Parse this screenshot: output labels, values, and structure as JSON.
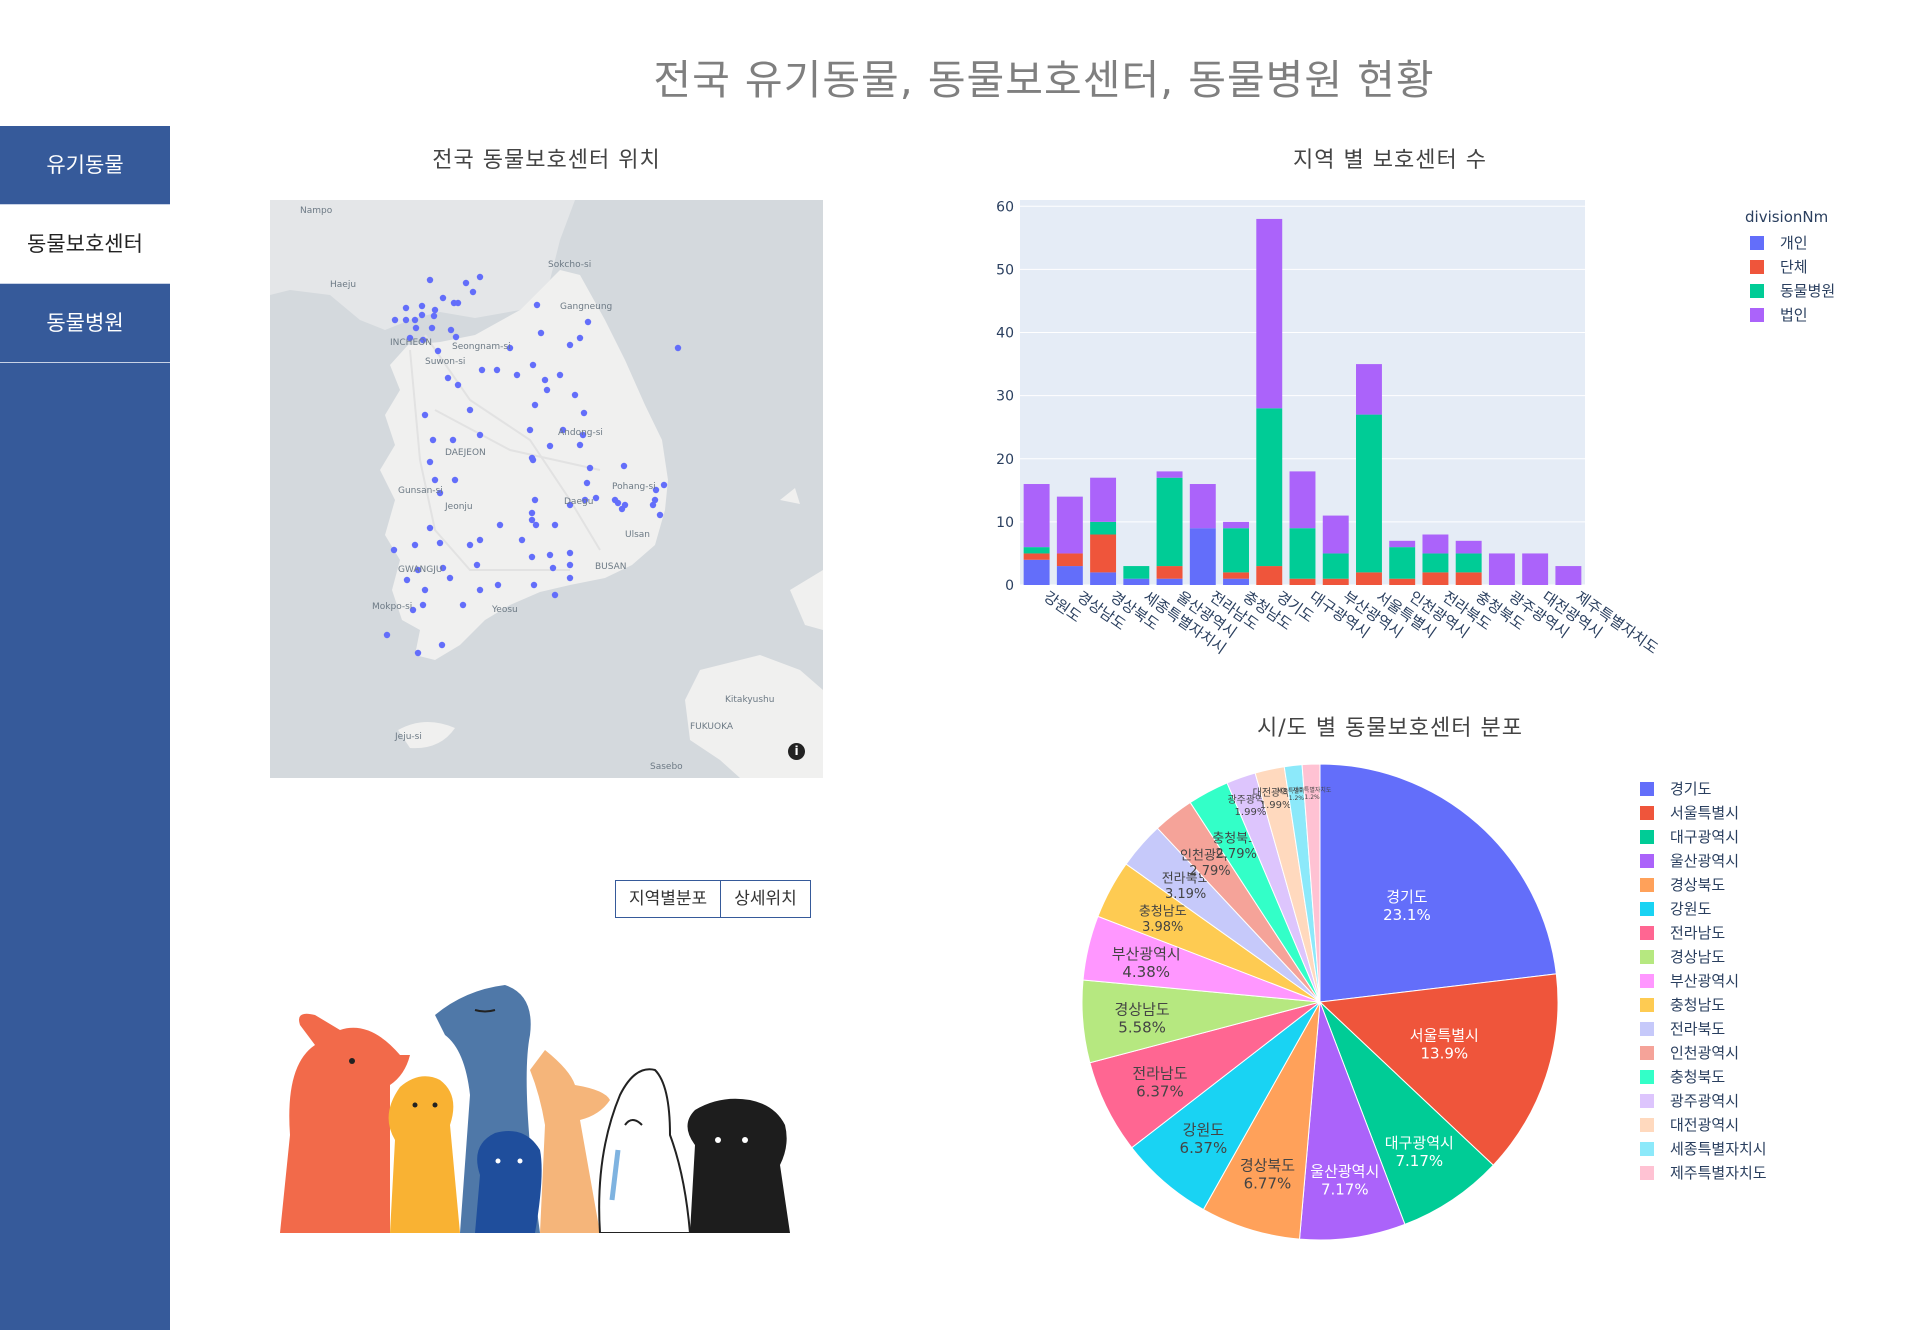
{
  "header": {
    "title": "전국 유기동물, 동물보호센터, 동물병원 현황"
  },
  "sidebar": {
    "items": [
      {
        "label": "유기동물",
        "active": false
      },
      {
        "label": "동물보호센터",
        "active": true
      },
      {
        "label": "동물병원",
        "active": false
      }
    ]
  },
  "map_panel": {
    "title": "전국 동물보호센터 위치",
    "point_color": "#636efa",
    "labels": [
      "Nampo",
      "Haeju",
      "Sokcho-si",
      "Gangneung",
      "INCHEON",
      "Seongnam-si",
      "Suwon-si",
      "Andong-si",
      "DAEJEON",
      "Pohang-si",
      "Gunsan-si",
      "Jeonju",
      "Daegu",
      "Ulsan",
      "GWANGJU",
      "BUSAN",
      "Mokpo-si",
      "Yeosu",
      "Kitakyushu",
      "FUKUOKA",
      "Jeju-si",
      "Sasebo"
    ],
    "info_icon": "i"
  },
  "buttons": {
    "region_dist": "지역별분포",
    "detail_location": "상세위치"
  },
  "bar_chart": {
    "title": "지역 별 보호센터 수",
    "legend_title": "divisionNm"
  },
  "pie_chart": {
    "title": "시/도 별 동물보호센터 분포"
  },
  "chart_data": [
    {
      "type": "bar",
      "title": "지역 별 보호센터 수",
      "legend_title": "divisionNm",
      "categories": [
        "강원도",
        "경상남도",
        "경상북도",
        "세종특별자치시",
        "울산광역시",
        "전라남도",
        "충청남도",
        "경기도",
        "대구광역시",
        "부산광역시",
        "서울특별시",
        "인천광역시",
        "전라북도",
        "충청북도",
        "광주광역시",
        "대전광역시",
        "제주특별자치도"
      ],
      "series": [
        {
          "name": "개인",
          "color": "#636efa",
          "values": [
            4,
            3,
            2,
            1,
            1,
            9,
            1,
            0,
            0,
            0,
            0,
            0,
            0,
            0,
            0,
            0,
            0
          ]
        },
        {
          "name": "단체",
          "color": "#ef553b",
          "values": [
            1,
            2,
            6,
            0,
            2,
            0,
            1,
            3,
            1,
            1,
            2,
            1,
            2,
            2,
            0,
            0,
            0
          ]
        },
        {
          "name": "동물병원",
          "color": "#00cc96",
          "values": [
            1,
            0,
            2,
            2,
            14,
            0,
            7,
            25,
            8,
            4,
            25,
            5,
            3,
            3,
            0,
            0,
            0
          ]
        },
        {
          "name": "법인",
          "color": "#ab63fa",
          "values": [
            10,
            9,
            7,
            0,
            1,
            7,
            1,
            30,
            9,
            6,
            8,
            1,
            3,
            2,
            5,
            5,
            3
          ]
        }
      ],
      "ylim": [
        0,
        61
      ],
      "yticks": [
        0,
        10,
        20,
        30,
        40,
        50,
        60
      ]
    },
    {
      "type": "pie",
      "title": "시/도 별 동물보호센터 분포",
      "labels": [
        "경기도",
        "서울특별시",
        "대구광역시",
        "울산광역시",
        "경상북도",
        "강원도",
        "전라남도",
        "경상남도",
        "부산광역시",
        "충청남도",
        "전라북도",
        "인천광역시",
        "충청북도",
        "광주광역시",
        "대전광역시",
        "세종특별자치시",
        "제주특별자치도"
      ],
      "values": [
        23.1,
        13.9,
        7.17,
        7.17,
        6.77,
        6.37,
        6.37,
        5.58,
        4.38,
        3.98,
        3.19,
        2.79,
        2.79,
        1.99,
        1.99,
        1.2,
        1.2
      ],
      "display_labels": [
        "23.1%",
        "13.9%",
        "7.17%",
        "7.17%",
        "6.77%",
        "6.37%",
        "6.37%",
        "5.58%",
        "4.38%",
        "3.98%",
        "3.19%",
        "2.79%",
        "2.79%",
        "1.99%",
        "1.99%",
        "1.2%",
        "1.2%"
      ],
      "colors": [
        "#636efa",
        "#ef553b",
        "#00cc96",
        "#ab63fa",
        "#ffa15a",
        "#19d3f3",
        "#ff6692",
        "#b6e880",
        "#ff97ff",
        "#fecb52",
        "#c6c9fa",
        "#f5a399",
        "#33ffc8",
        "#ddc5fd",
        "#ffd9be",
        "#8ce9fa",
        "#ffc2d3"
      ]
    }
  ]
}
